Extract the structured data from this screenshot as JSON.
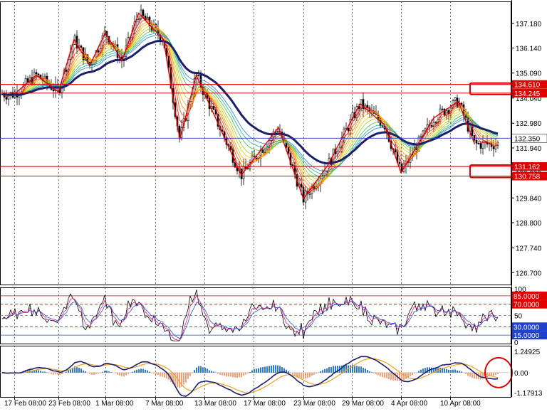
{
  "chart_data": [
    {
      "type": "line",
      "panel": "price",
      "ylim": [
        126.2,
        138.1
      ],
      "y_ticks": [
        "137.180",
        "136.140",
        "135.090",
        "134.040",
        "132.980",
        "131.940",
        "130.890",
        "129.840",
        "128.800",
        "127.740",
        "126.700"
      ],
      "x_ticks": [
        "17 Feb 08:00",
        "23 Feb 08:00",
        "1 Mar 08:00",
        "7 Mar 08:00",
        "13 Mar 08:00",
        "17 Mar 08:00",
        "23 Mar 08:00",
        "29 Mar 08:00",
        "4 Apr 08:00",
        "10 Apr 08:00"
      ],
      "current_price": 132.35,
      "horizontal_levels": [
        134.61,
        134.245,
        131.162,
        130.758
      ],
      "zigzag": [
        {
          "x": "17 Feb 08:00",
          "y": 134.2
        },
        {
          "x": "20 Feb 08:00",
          "y": 135.0
        },
        {
          "x": "23 Feb 08:00",
          "y": 134.3
        },
        {
          "x": "25 Feb 08:00",
          "y": 136.5
        },
        {
          "x": "27 Feb 08:00",
          "y": 135.4
        },
        {
          "x": "1 Mar 08:00",
          "y": 136.8
        },
        {
          "x": "3 Mar 08:00",
          "y": 135.6
        },
        {
          "x": "5 Mar 08:00",
          "y": 137.6
        },
        {
          "x": "8 Mar 08:00",
          "y": 136.5
        },
        {
          "x": "10 Mar 08:00",
          "y": 132.3
        },
        {
          "x": "12 Mar 08:00",
          "y": 135.0
        },
        {
          "x": "16 Mar 08:00",
          "y": 130.8
        },
        {
          "x": "20 Mar 08:00",
          "y": 132.8
        },
        {
          "x": "23 Mar 08:00",
          "y": 129.8
        },
        {
          "x": "26 Mar 08:00",
          "y": 131.2
        },
        {
          "x": "30 Mar 08:00",
          "y": 133.8
        },
        {
          "x": "2 Apr 08:00",
          "y": 132.9
        },
        {
          "x": "4 Apr 08:00",
          "y": 130.9
        },
        {
          "x": "8 Apr 08:00",
          "y": 133.2
        },
        {
          "x": "11 Apr 08:00",
          "y": 133.9
        },
        {
          "x": "12 Apr 08:00",
          "y": 133.0
        },
        {
          "x": "13 Apr 08:00",
          "y": 132.1
        }
      ]
    },
    {
      "type": "line",
      "panel": "oscillator",
      "ylim": [
        0,
        100
      ],
      "levels": [
        85.0,
        70.0,
        50.0,
        30.0,
        15.0
      ],
      "level_labels": [
        "85.0000",
        "70.0000",
        "30.0000",
        "15.0000"
      ],
      "top_label": "100",
      "bottom_label": "0",
      "mid_label": "50"
    },
    {
      "type": "bar",
      "panel": "macd",
      "ylim": [
        -1.17913,
        1.24925
      ],
      "y_ticks": [
        "1.24925",
        "0.00",
        "-1.17913"
      ]
    }
  ]
}
